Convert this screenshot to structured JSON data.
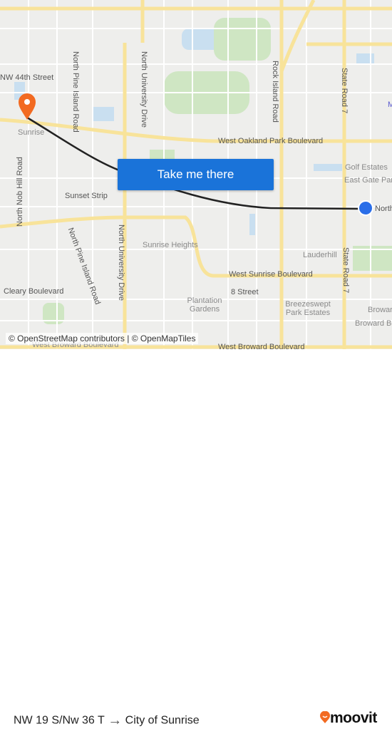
{
  "map": {
    "labels": {
      "nw44": "NW 44th Street",
      "npine1": "North Pine Island Road",
      "nuniv1": "North University Drive",
      "rock": "Rock Island Road",
      "sr7a": "State Road 7",
      "sunrise": "Sunrise",
      "oakland": "West Oakland Park Boulevard",
      "nob": "North Nob Hill Road",
      "strip": "Sunset Strip",
      "golf": "Golf Estates",
      "eastgate": "East Gate Park",
      "northwest": "Northwest",
      "npine2": "North Pine Island Road",
      "nuniv2": "North University Drive",
      "heights": "Sunrise Heights",
      "lauder": "Lauderhill",
      "wsunrise": "West Sunrise Boulevard",
      "sr7b": "State Road 7",
      "cleary": "Cleary Boulevard",
      "eight": "8 Street",
      "plantation": "Plantation Gardens",
      "breeze": "Breezeswept Park Estates",
      "browa": "Broward",
      "browardb": "Broward Boulevard",
      "wbroward1": "West Broward Boulevard",
      "wbroward2": "West Broward Boulevard",
      "m": "M"
    },
    "attribution": "© OpenStreetMap contributors | © OpenMapTiles",
    "colors": {
      "route": "#222222",
      "origin_pin": "#f26a21",
      "destination_dot": "#2a6ee8",
      "button": "#1a73d9"
    }
  },
  "cta": {
    "label": "Take me there"
  },
  "footer": {
    "origin": "NW 19 S/Nw 36 T",
    "arrow": "→",
    "destination": "City of Sunrise",
    "brand": "moovit"
  }
}
